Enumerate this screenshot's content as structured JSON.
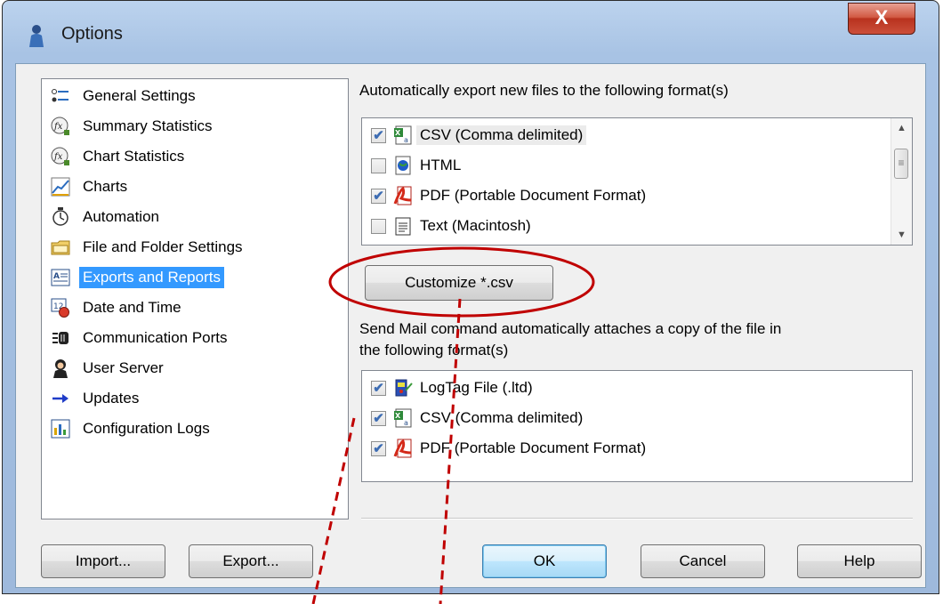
{
  "window": {
    "title": "Options",
    "close_label": "X"
  },
  "nav": {
    "items": [
      {
        "label": "General Settings",
        "icon": "settings-list-icon"
      },
      {
        "label": "Summary Statistics",
        "icon": "statistics-icon"
      },
      {
        "label": "Chart Statistics",
        "icon": "statistics-icon"
      },
      {
        "label": "Charts",
        "icon": "chart-icon"
      },
      {
        "label": "Automation",
        "icon": "stopwatch-icon"
      },
      {
        "label": "File and Folder Settings",
        "icon": "folder-icon"
      },
      {
        "label": "Exports and Reports",
        "icon": "report-icon",
        "selected": true
      },
      {
        "label": "Date and Time",
        "icon": "calendar-clock-icon"
      },
      {
        "label": "Communication Ports",
        "icon": "port-icon"
      },
      {
        "label": "User Server",
        "icon": "user-server-icon"
      },
      {
        "label": "Updates",
        "icon": "arrow-right-icon"
      },
      {
        "label": "Configuration Logs",
        "icon": "config-log-icon"
      }
    ]
  },
  "export": {
    "heading": "Automatically export new files to the following format(s)",
    "formats": [
      {
        "label": "CSV (Comma delimited)",
        "checked": true,
        "icon": "csv-icon"
      },
      {
        "label": "HTML",
        "checked": false,
        "icon": "html-icon"
      },
      {
        "label": "PDF (Portable Document Format)",
        "checked": true,
        "icon": "pdf-icon"
      },
      {
        "label": "Text (Macintosh)",
        "checked": false,
        "icon": "text-icon"
      }
    ],
    "customize_label": "Customize *.csv"
  },
  "mail": {
    "heading_line1": "Send Mail command automatically attaches a copy of the file in",
    "heading_line2": "the following format(s)",
    "formats": [
      {
        "label": "LogTag File (.ltd)",
        "checked": true,
        "icon": "logtag-icon"
      },
      {
        "label": "CSV (Comma delimited)",
        "checked": true,
        "icon": "csv-icon"
      },
      {
        "label": "PDF (Portable Document Format)",
        "checked": true,
        "icon": "pdf-icon"
      }
    ]
  },
  "buttons": {
    "import": "Import...",
    "export": "Export...",
    "ok": "OK",
    "cancel": "Cancel",
    "help": "Help"
  },
  "colors": {
    "selection": "#3399ff",
    "annotation": "#c00000"
  }
}
